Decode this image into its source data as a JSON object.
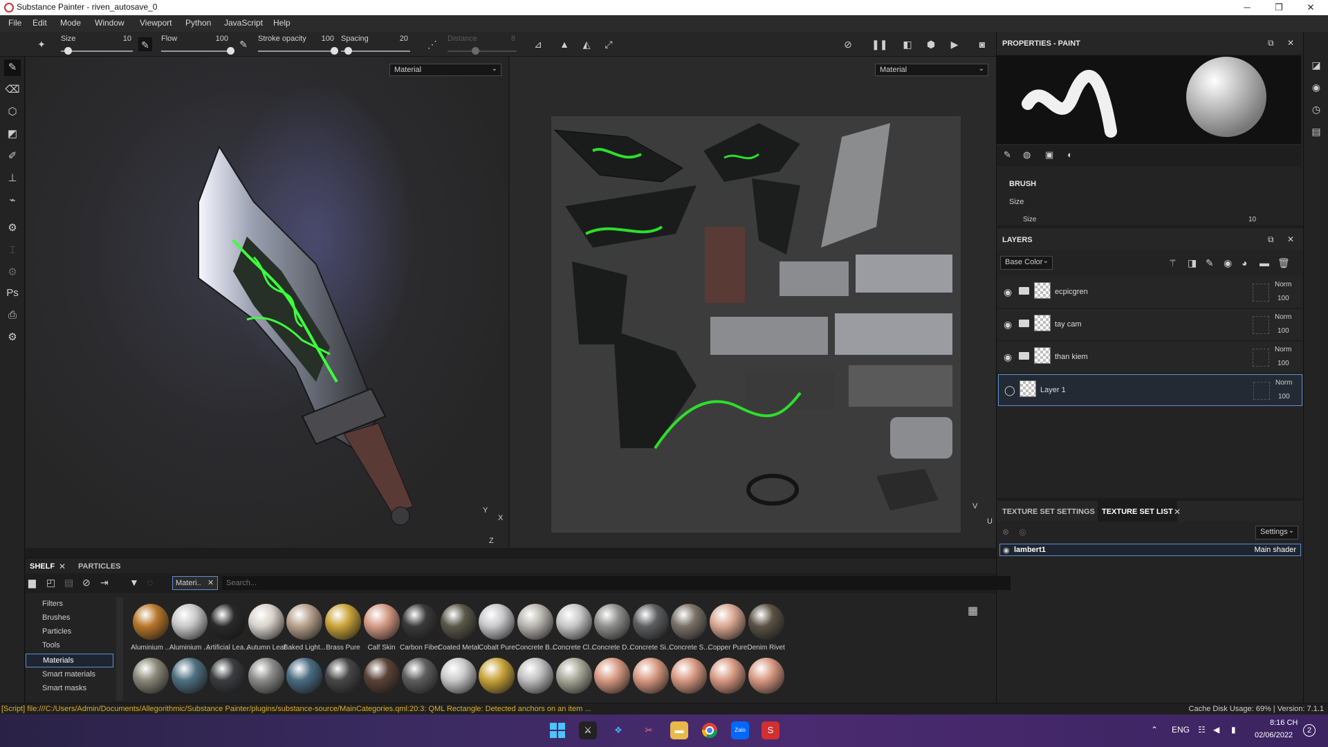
{
  "window": {
    "title": "Substance Painter - riven_autosave_0",
    "minimize": "─",
    "maximize": "❐",
    "close": "✕"
  },
  "menu": [
    "File",
    "Edit",
    "Mode",
    "Window",
    "Viewport",
    "Python",
    "JavaScript",
    "Help"
  ],
  "toolbar": {
    "size_label": "Size",
    "size_value": "10",
    "size_level": 0.1,
    "flow_label": "Flow",
    "flow_value": "100",
    "flow_level": 1.0,
    "opacity_label": "Stroke opacity",
    "opacity_value": "100",
    "opacity_level": 1.0,
    "spacing_label": "Spacing",
    "spacing_value": "20",
    "spacing_level": 0.1,
    "distance_label": "Distance",
    "distance_value": "8",
    "distance_level": 0.4
  },
  "viewport3d": {
    "channel": "Material",
    "axes": {
      "y": "Y",
      "x": "X",
      "z": "Z"
    }
  },
  "viewport2d": {
    "channel": "Material",
    "axes": {
      "v": "V",
      "u": "U"
    }
  },
  "properties": {
    "title": "PROPERTIES - PAINT",
    "section": "BRUSH",
    "size_group": "Size",
    "size_label": "Size",
    "size_value": "10"
  },
  "layers": {
    "title": "LAYERS",
    "channel": "Base Color",
    "items": [
      {
        "name": "ecpicgren",
        "blend": "Norm",
        "opacity": "100"
      },
      {
        "name": "tay cam",
        "blend": "Norm",
        "opacity": "100"
      },
      {
        "name": "than kiem",
        "blend": "Norm",
        "opacity": "100"
      },
      {
        "name": "Layer 1",
        "blend": "Norm",
        "opacity": "100"
      }
    ]
  },
  "texture_sets": {
    "tab_settings": "TEXTURE SET SETTINGS",
    "tab_list": "TEXTURE SET LIST",
    "settings_button": "Settings",
    "items": [
      {
        "name": "lambert1",
        "shader": "Main shader"
      }
    ]
  },
  "shelf": {
    "tabs": [
      "SHELF",
      "PARTICLES"
    ],
    "filter_tag": "Materi..",
    "search_placeholder": "Search...",
    "categories": [
      "Filters",
      "Brushes",
      "Particles",
      "Tools",
      "Materials",
      "Smart materials",
      "Smart masks"
    ],
    "materials_row1": [
      {
        "label": "Aluminium ...",
        "color": "#b8772a"
      },
      {
        "label": "Aluminium ...",
        "color": "#c9c9c9"
      },
      {
        "label": "Artificial Lea...",
        "color": "#2a2a2a"
      },
      {
        "label": "Autumn Leaf",
        "color": "#d9d2cc"
      },
      {
        "label": "Baked Light...",
        "color": "#b7a08c"
      },
      {
        "label": "Brass Pure",
        "color": "#c9a43a"
      },
      {
        "label": "Calf Skin",
        "color": "#d59a84"
      },
      {
        "label": "Carbon Fiber",
        "color": "#3a3a3a"
      },
      {
        "label": "Coated Metal",
        "color": "#5a5848"
      },
      {
        "label": "Cobalt Pure",
        "color": "#c8c8cc"
      },
      {
        "label": "Concrete B...",
        "color": "#b8b5ae"
      },
      {
        "label": "Concrete Cl...",
        "color": "#c6c7c6"
      },
      {
        "label": "Concrete D...",
        "color": "#8f8f8c"
      },
      {
        "label": "Concrete Si...",
        "color": "#5c5e60"
      },
      {
        "label": "Concrete S...",
        "color": "#7a7268"
      },
      {
        "label": "Copper Pure",
        "color": "#d8a890"
      },
      {
        "label": "Denim Rivet",
        "color": "#5a5244"
      }
    ],
    "materials_row2": [
      "#8a8878",
      "#4f7080",
      "#3a3d40",
      "#8c8c8a",
      "#4a6c82",
      "#474747",
      "#5a4236",
      "#5e5e5e",
      "#cacaca",
      "#c9a43a",
      "#c0c0c0",
      "#a9a898",
      "#d89a82",
      "#d89a82",
      "#d89a82",
      "#d89a82",
      "#d89a82"
    ]
  },
  "status": {
    "message": "[Script] file:///C:/Users/Admin/Documents/Allegorithmic/Substance Painter/plugins/substance-source/MainCategories.qml:20:3: QML Rectangle: Detected anchors on an item ...",
    "cache": "Cache Disk Usage:    69% | Version: 7.1.1"
  },
  "taskbar": {
    "language": "ENG",
    "time": "8:16 CH",
    "date": "02/06/2022",
    "notifications": "2",
    "chat_app": "Zalo"
  }
}
